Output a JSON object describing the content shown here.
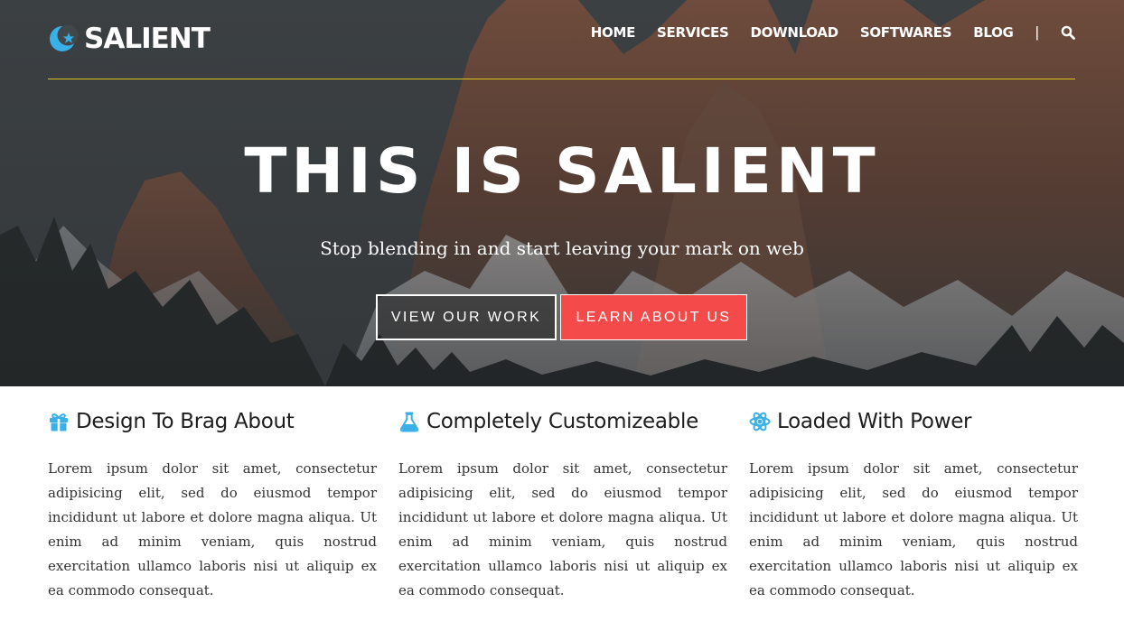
{
  "brand": {
    "name": "SALIENT",
    "logo_icon": "crescent-star-icon",
    "accent_color": "#3ab0e8"
  },
  "nav": {
    "items": [
      {
        "label": "HOME"
      },
      {
        "label": "SERVICES"
      },
      {
        "label": "DOWNLOAD"
      },
      {
        "label": "SOFTWARES"
      },
      {
        "label": "BLOG"
      }
    ],
    "separator": "|",
    "search_icon": "search-icon"
  },
  "hero": {
    "title": "THIS IS SALIENT",
    "subtitle": "Stop blending in and start leaving your mark on web",
    "primary_button": "VIEW OUR WORK",
    "secondary_button": "LEARN ABOUT US",
    "secondary_button_color": "#f44a4a",
    "header_line_color": "#d8c41c"
  },
  "features": [
    {
      "icon": "gift-icon",
      "title": "Design To Brag About",
      "text": "Lorem ipsum dolor sit amet, consectetur adipisicing elit, sed do eiusmod tempor incididunt ut labore et dolore magna aliqua. Ut enim ad minim veniam, quis nostrud exercitation ullamco laboris nisi ut aliquip ex ea commodo consequat."
    },
    {
      "icon": "flask-icon",
      "title": "Completely Customizeable",
      "text": "Lorem ipsum dolor sit amet, consectetur adipisicing elit, sed do eiusmod tempor incididunt ut labore et dolore magna aliqua. Ut enim ad minim veniam, quis nostrud exercitation ullamco laboris nisi ut aliquip ex ea commodo consequat."
    },
    {
      "icon": "atom-icon",
      "title": "Loaded With Power",
      "text": "Lorem ipsum dolor sit amet, consectetur adipisicing elit, sed do eiusmod tempor incididunt ut labore et dolore magna aliqua. Ut enim ad minim veniam, quis nostrud exercitation ullamco laboris nisi ut aliquip ex ea commodo consequat."
    }
  ]
}
